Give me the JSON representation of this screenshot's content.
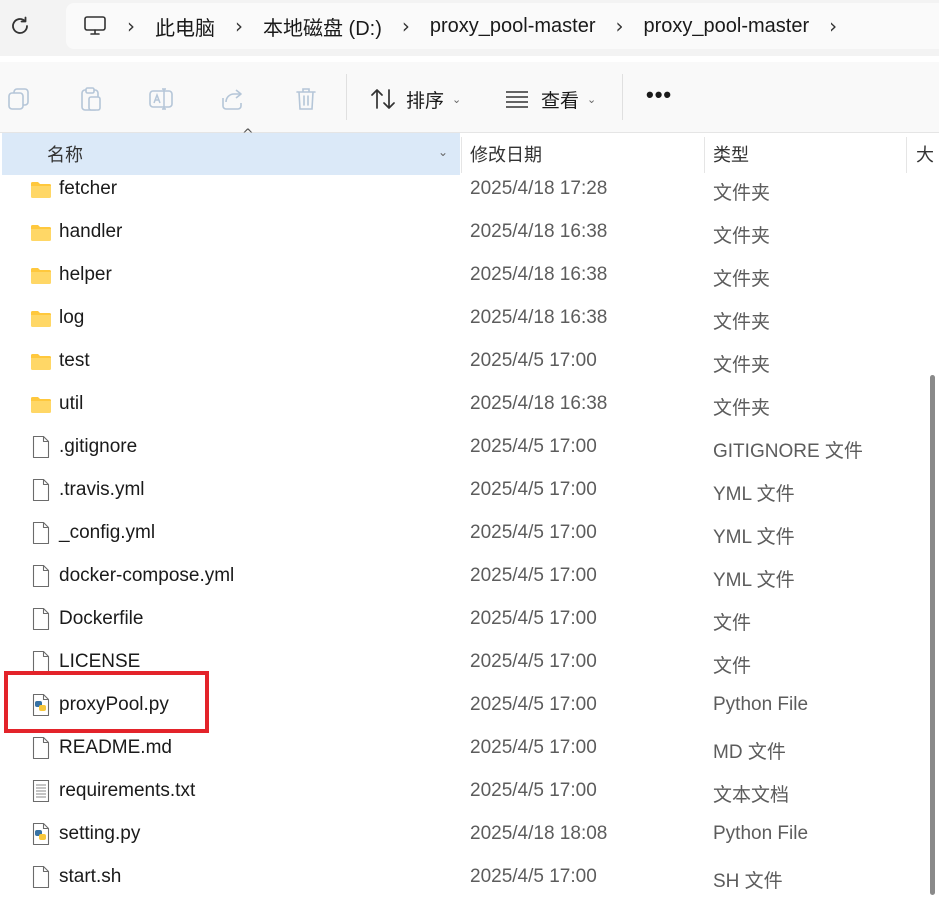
{
  "address": {
    "crumbs": [
      "此电脑",
      "本地磁盘 (D:)",
      "proxy_pool-master",
      "proxy_pool-master"
    ]
  },
  "toolbar": {
    "sort_label": "排序",
    "view_label": "查看",
    "more_label": "•••"
  },
  "columns": {
    "name": "名称",
    "modified": "修改日期",
    "type": "类型",
    "size": "大"
  },
  "files": [
    {
      "name": "fetcher",
      "date": "2025/4/18 17:28",
      "type": "文件夹",
      "icon": "folder-icon"
    },
    {
      "name": "handler",
      "date": "2025/4/18 16:38",
      "type": "文件夹",
      "icon": "folder-icon"
    },
    {
      "name": "helper",
      "date": "2025/4/18 16:38",
      "type": "文件夹",
      "icon": "folder-icon"
    },
    {
      "name": "log",
      "date": "2025/4/18 16:38",
      "type": "文件夹",
      "icon": "folder-icon"
    },
    {
      "name": "test",
      "date": "2025/4/5 17:00",
      "type": "文件夹",
      "icon": "folder-icon"
    },
    {
      "name": "util",
      "date": "2025/4/18 16:38",
      "type": "文件夹",
      "icon": "folder-icon"
    },
    {
      "name": ".gitignore",
      "date": "2025/4/5 17:00",
      "type": "GITIGNORE 文件",
      "icon": "file-icon"
    },
    {
      "name": ".travis.yml",
      "date": "2025/4/5 17:00",
      "type": "YML 文件",
      "icon": "file-icon"
    },
    {
      "name": "_config.yml",
      "date": "2025/4/5 17:00",
      "type": "YML 文件",
      "icon": "file-icon"
    },
    {
      "name": "docker-compose.yml",
      "date": "2025/4/5 17:00",
      "type": "YML 文件",
      "icon": "file-icon"
    },
    {
      "name": "Dockerfile",
      "date": "2025/4/5 17:00",
      "type": "文件",
      "icon": "file-icon"
    },
    {
      "name": "LICENSE",
      "date": "2025/4/5 17:00",
      "type": "文件",
      "icon": "file-icon"
    },
    {
      "name": "proxyPool.py",
      "date": "2025/4/5 17:00",
      "type": "Python File",
      "icon": "python-file-icon"
    },
    {
      "name": "README.md",
      "date": "2025/4/5 17:00",
      "type": "MD 文件",
      "icon": "file-icon"
    },
    {
      "name": "requirements.txt",
      "date": "2025/4/5 17:00",
      "type": "文本文档",
      "icon": "text-file-icon"
    },
    {
      "name": "setting.py",
      "date": "2025/4/18 18:08",
      "type": "Python File",
      "icon": "python-file-icon"
    },
    {
      "name": "start.sh",
      "date": "2025/4/5 17:00",
      "type": "SH 文件",
      "icon": "file-icon"
    }
  ],
  "colors": {
    "highlight_box": "#e3232a",
    "header_selected": "#dbe9f8",
    "folder": "#ffc83d"
  }
}
